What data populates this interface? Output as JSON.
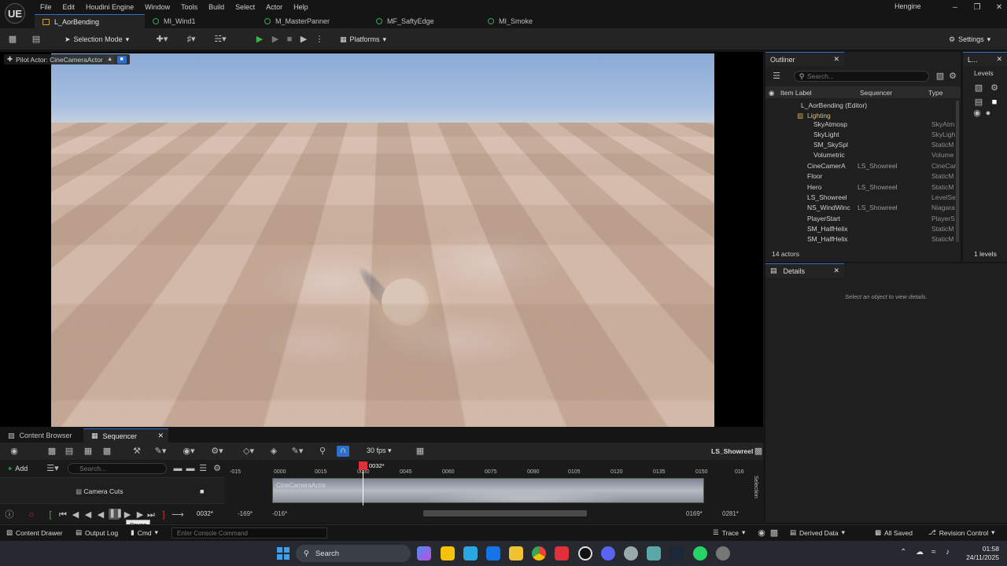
{
  "app": {
    "logo": "UE",
    "project_name": "Hengine"
  },
  "menu": [
    "File",
    "Edit",
    "Houdini Engine",
    "Window",
    "Tools",
    "Build",
    "Select",
    "Actor",
    "Help"
  ],
  "tabs": [
    "L_AorBending",
    "MI_Wind1",
    "M_MasterPanner",
    "MF_SaftyEdge",
    "MI_Smoke"
  ],
  "toolbar": {
    "selection_mode": "Selection Mode",
    "platforms": "Platforms",
    "settings": "Settings"
  },
  "viewport": {
    "pilot_label": "Pilot Actor: CineCameraActor"
  },
  "outliner": {
    "tab": "Outliner",
    "search_placeholder": "Search...",
    "columns": {
      "label": "Item Label",
      "sequencer": "Sequencer",
      "type": "Type"
    },
    "rows": [
      {
        "label": "L_AorBending (Editor)",
        "seq": "",
        "type": ""
      },
      {
        "label": "Lighting",
        "seq": "",
        "type": ""
      },
      {
        "label": "SkyAtmosp",
        "seq": "",
        "type": "SkyAtm"
      },
      {
        "label": "SkyLight",
        "seq": "",
        "type": "SkyLigh"
      },
      {
        "label": "SM_SkySpl",
        "seq": "",
        "type": "StaticM"
      },
      {
        "label": "Volumetric",
        "seq": "",
        "type": "Volume"
      },
      {
        "label": "CineCamerA",
        "seq": "LS_Showreel",
        "type": "CineCar"
      },
      {
        "label": "Floor",
        "seq": "",
        "type": "StaticM"
      },
      {
        "label": "Hero",
        "seq": "LS_Showreel",
        "type": "StaticM"
      },
      {
        "label": "LS_Showreel",
        "seq": "",
        "type": "LevelSe"
      },
      {
        "label": "NS_WindWinc",
        "seq": "LS_Showreel",
        "type": "Niagara"
      },
      {
        "label": "PlayerStart",
        "seq": "",
        "type": "PlayerS"
      },
      {
        "label": "SM_HalfHelix",
        "seq": "",
        "type": "StaticM"
      },
      {
        "label": "SM_HalfHelix",
        "seq": "",
        "type": "StaticM"
      }
    ],
    "actor_count": "14 actors"
  },
  "levels": {
    "tab": "L...",
    "header": "Levels",
    "count": "1 levels"
  },
  "details": {
    "tab": "Details",
    "empty_text": "Select an object to view details."
  },
  "bottom_tabs": {
    "content_browser": "Content Browser",
    "sequencer": "Sequencer"
  },
  "sequencer": {
    "add": "Add",
    "search_placeholder": "Search...",
    "fps": "30 fps",
    "sequence_name": "LS_Showreel",
    "track_name": "Camera Cuts",
    "clip_label": "CineCameraActor",
    "playhead_frame": "0032*",
    "current_frame": "0032*",
    "start_frame": "-169*",
    "view_start": "-016*",
    "view_end": "0169*",
    "end_frame": "0281*",
    "ruler": [
      "-015",
      "0000",
      "0015",
      "0030",
      "0045",
      "0060",
      "0075",
      "0090",
      "0105",
      "0120",
      "0135",
      "0150",
      "016"
    ],
    "selection_label": "Selection",
    "tooltip": "Pause"
  },
  "statusbar": {
    "content_drawer": "Content Drawer",
    "output_log": "Output Log",
    "cmd": "Cmd",
    "console_placeholder": "Enter Console Command",
    "trace": "Trace",
    "derived_data": "Derived Data",
    "all_saved": "All Saved",
    "revision_control": "Revision Control"
  },
  "taskbar": {
    "search": "Search",
    "time": "01:58",
    "date": "24/11/2025"
  },
  "colors": {
    "accent": "#2f6fcc",
    "playhead": "#e0303a",
    "play_green": "#3bb54a"
  }
}
